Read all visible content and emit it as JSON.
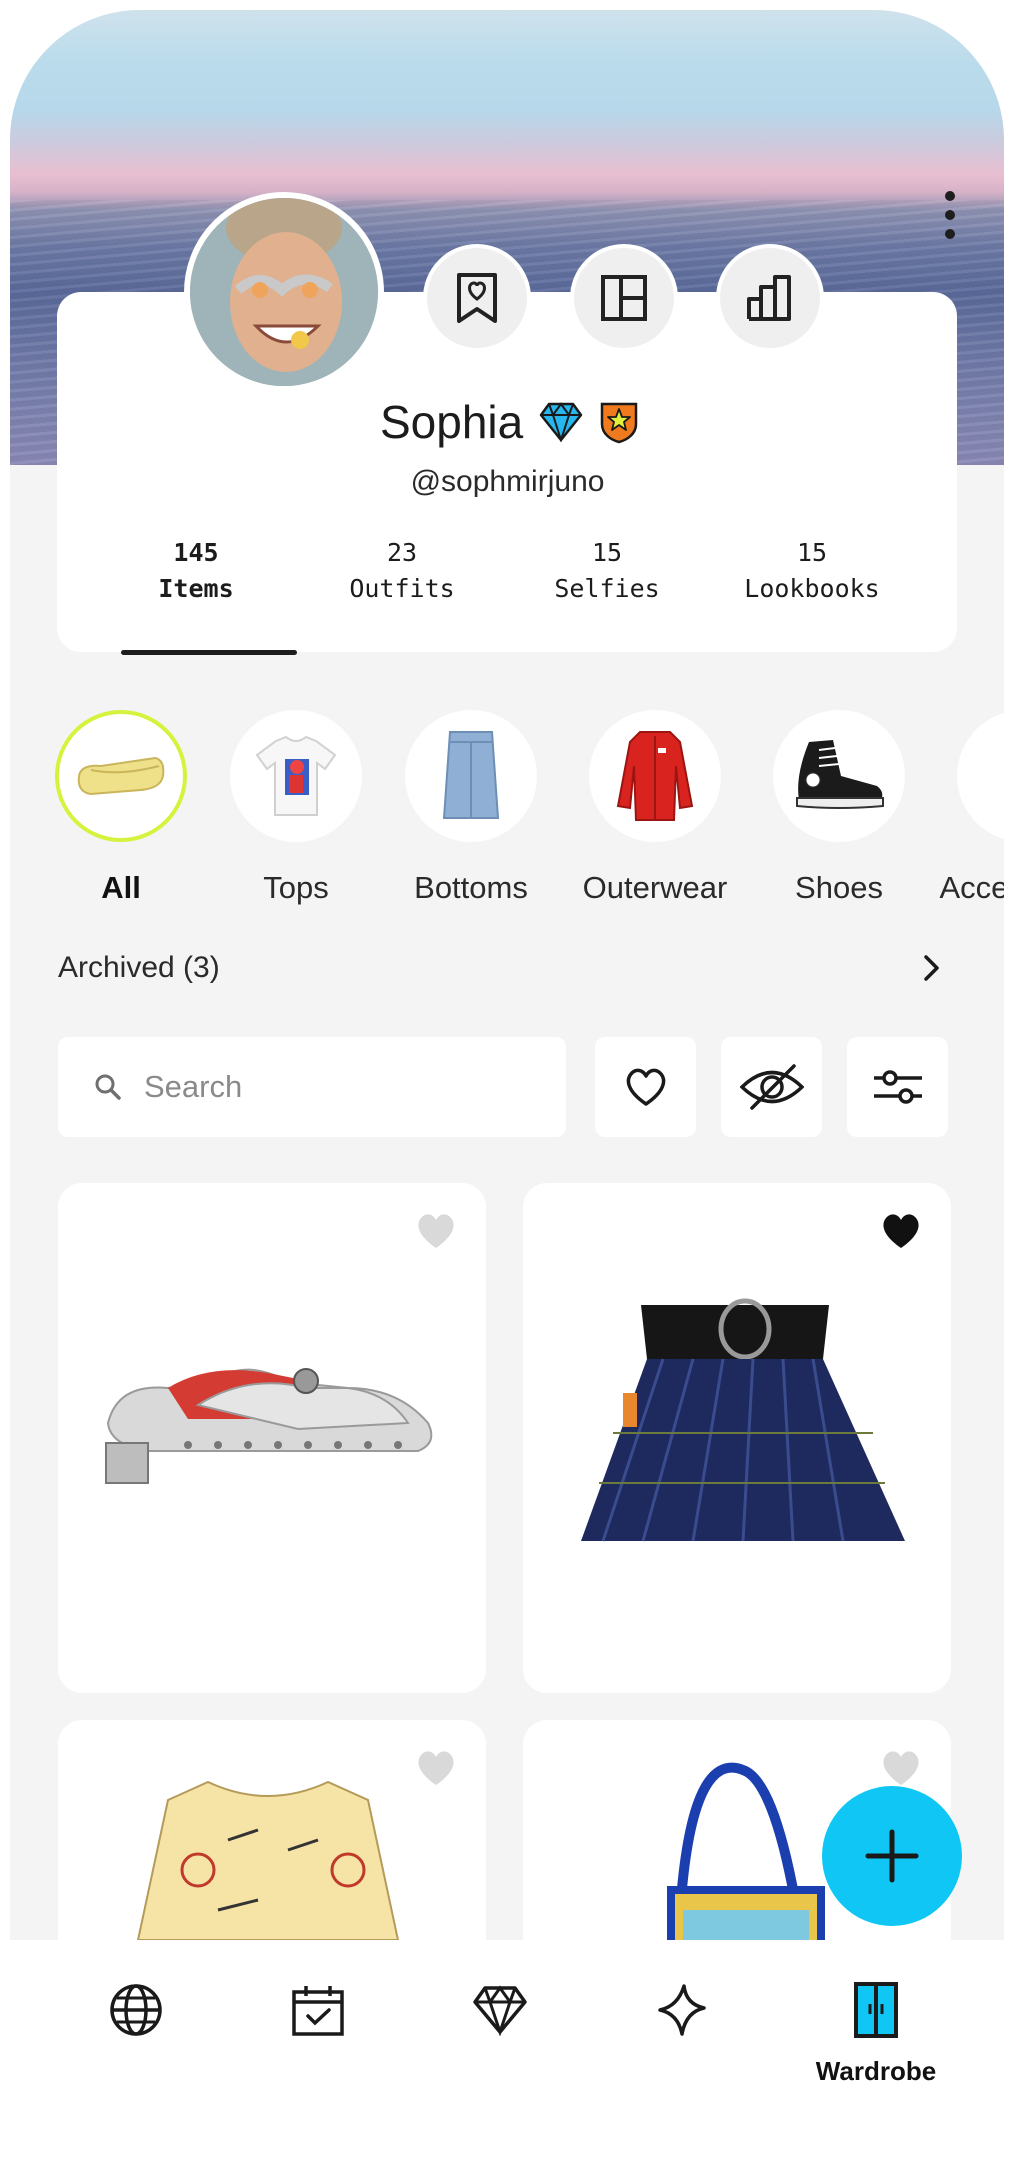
{
  "profile": {
    "name": "Sophia",
    "handle": "@sophmirjuno",
    "badges": [
      "diamond-badge-icon",
      "star-shield-badge-icon"
    ]
  },
  "header_actions": [
    {
      "icon": "bookmark-heart-icon"
    },
    {
      "icon": "layout-grid-icon"
    },
    {
      "icon": "bar-chart-icon"
    }
  ],
  "stats": [
    {
      "count": "145",
      "label": "Items",
      "active": true
    },
    {
      "count": "23",
      "label": "Outfits",
      "active": false
    },
    {
      "count": "15",
      "label": "Selfies",
      "active": false
    },
    {
      "count": "15",
      "label": "Lookbooks",
      "active": false
    }
  ],
  "categories": [
    {
      "label": "All",
      "active": true
    },
    {
      "label": "Tops",
      "active": false
    },
    {
      "label": "Bottoms",
      "active": false
    },
    {
      "label": "Outerwear",
      "active": false
    },
    {
      "label": "Shoes",
      "active": false
    },
    {
      "label": "Accessories",
      "active": false
    }
  ],
  "archived": {
    "label": "Archived (3)"
  },
  "search": {
    "placeholder": "Search",
    "value": ""
  },
  "filters": [
    {
      "icon": "heart-outline-icon"
    },
    {
      "icon": "eye-off-icon"
    },
    {
      "icon": "sliders-icon"
    }
  ],
  "items": [
    {
      "name": "Studded clog",
      "favorite": false
    },
    {
      "name": "Pleated tartan mini skirt",
      "favorite": true
    },
    {
      "name": "Printed camp shirt",
      "favorite": false
    },
    {
      "name": "Crochet tote bag",
      "favorite": false
    }
  ],
  "bottom_nav": [
    {
      "icon": "globe-icon",
      "label": "",
      "active": false
    },
    {
      "icon": "calendar-check-icon",
      "label": "",
      "active": false
    },
    {
      "icon": "diamond-icon",
      "label": "",
      "active": false
    },
    {
      "icon": "sparkle-icon",
      "label": "",
      "active": false
    },
    {
      "icon": "wardrobe-icon",
      "label": "Wardrobe",
      "active": true
    }
  ],
  "colors": {
    "accent": "#0fc6f5",
    "active_category_ring": "#d6f23d",
    "background": "#f4f4f4"
  }
}
